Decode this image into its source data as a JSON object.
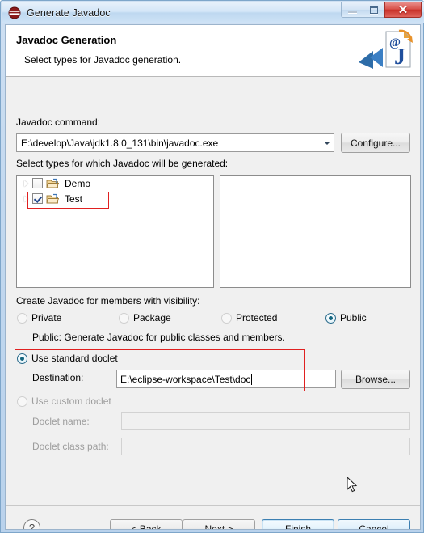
{
  "window": {
    "title": "Generate Javadoc",
    "icon": "javadoc-app-icon",
    "buttons": {
      "minimize": "minimize-icon",
      "maximize": "maximize-icon",
      "close": "✕"
    }
  },
  "banner": {
    "title": "Javadoc Generation",
    "subtitle": "Select types for Javadoc generation.",
    "art_icon": "javadoc-page-icon",
    "art_letter": "J",
    "art_at": "@"
  },
  "command": {
    "label": "Javadoc command:",
    "value": "E:\\develop\\Java\\jdk1.8.0_131\\bin\\javadoc.exe",
    "configure_label": "Configure..."
  },
  "types": {
    "label": "Select types for which Javadoc will be generated:",
    "tree": [
      {
        "name": "Demo",
        "checked": false,
        "expandable": true,
        "icon": "package-icon"
      },
      {
        "name": "Test",
        "checked": true,
        "expandable": true,
        "icon": "package-icon",
        "highlighted": true
      }
    ],
    "right_panel_items": []
  },
  "visibility": {
    "label": "Create Javadoc for members with visibility:",
    "options": [
      {
        "label": "Private",
        "selected": false
      },
      {
        "label": "Package",
        "selected": false
      },
      {
        "label": "Protected",
        "selected": false
      },
      {
        "label": "Public",
        "selected": true
      }
    ],
    "description": "Public: Generate Javadoc for public classes and members."
  },
  "doclet": {
    "standard": {
      "label": "Use standard doclet",
      "selected": true
    },
    "destination": {
      "label": "Destination:",
      "value": "E:\\eclipse-workspace\\Test\\doc",
      "browse_label": "Browse..."
    },
    "custom": {
      "label": "Use custom doclet",
      "selected": false,
      "enabled": false
    },
    "doclet_name": {
      "label": "Doclet name:",
      "value": "",
      "enabled": false
    },
    "doclet_class_path": {
      "label": "Doclet class path:",
      "value": "",
      "enabled": false
    }
  },
  "footer": {
    "help_label": "?",
    "back_label": "< Back",
    "next_label": "Next >",
    "finish_label": "Finish",
    "cancel_label": "Cancel"
  },
  "colors": {
    "accent_blue": "#3c7fb1",
    "annotation_red": "#e02020",
    "title_close_red": "#c8322a",
    "radio_dot": "#14657f"
  }
}
